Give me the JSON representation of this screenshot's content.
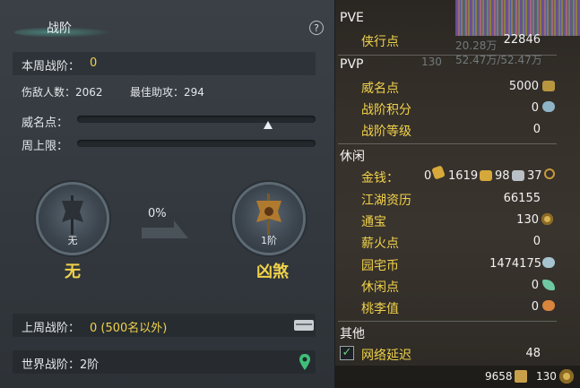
{
  "left": {
    "title": "战阶",
    "help_label": "?",
    "week_rank_label": "本周战阶：",
    "week_rank_value": "0",
    "enemies_label": "伤敌人数：2062",
    "best_assist_label": "最佳助攻：294",
    "prestige_label": "威名点：",
    "weekly_cap_label": "周上限：",
    "prestige_level": 0.8,
    "current_rank": {
      "small": "无",
      "big": "无"
    },
    "progress_percent": "0%",
    "next_rank": {
      "small": "1阶",
      "big": "凶煞"
    },
    "last_week_label": "上周战阶：",
    "last_week_value": "0 (500名以外)",
    "world_rank_label": "世界战阶：2阶"
  },
  "right": {
    "pve": {
      "title": "PVE",
      "items": [
        {
          "label": "侠行点",
          "value": "22846"
        }
      ]
    },
    "pvp": {
      "title": "PVP",
      "items": [
        {
          "label": "威名点",
          "value": "5000"
        },
        {
          "label": "战阶积分",
          "value": "0"
        },
        {
          "label": "战阶等级",
          "value": "0"
        }
      ]
    },
    "leisure": {
      "title": "休闲",
      "money_label": "金钱：",
      "money_values": [
        "0",
        "1619",
        "98",
        "37"
      ],
      "items": [
        {
          "label": "江湖资历",
          "value": "66155"
        },
        {
          "label": "通宝",
          "value": "130"
        },
        {
          "label": "薪火点",
          "value": "0"
        },
        {
          "label": "园宅币",
          "value": "1474175"
        },
        {
          "label": "休闲点",
          "value": "0"
        },
        {
          "label": "桃李值",
          "value": "0"
        }
      ]
    },
    "other": {
      "title": "其他",
      "latency_label": "网络延迟",
      "latency_value": "48"
    },
    "footer": {
      "left_value": "9658",
      "right_value": "130"
    },
    "ghost_texts": [
      "20.28万",
      "52.47万/52.47万",
      "130"
    ],
    "colors": {
      "accent_yellow": "#f0d24a"
    }
  }
}
